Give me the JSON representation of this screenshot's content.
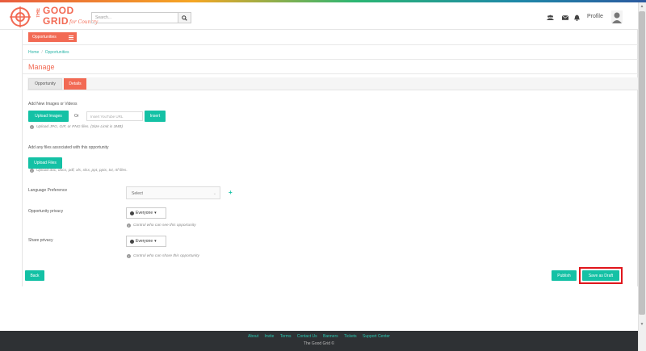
{
  "header": {
    "logo": {
      "line1": "THE",
      "line2": "GOOD",
      "line3": "GRID",
      "tagline": "for Country"
    },
    "search": {
      "placeholder": "Search..."
    },
    "profile_label": "Profile",
    "icons": [
      "users-icon",
      "mail-icon",
      "bell-icon"
    ]
  },
  "nav": {
    "opportunities_button": "Opportunities"
  },
  "breadcrumb": {
    "home": "Home",
    "separator": "/",
    "current": "Opportunities"
  },
  "page": {
    "title": "Manage"
  },
  "tabs": [
    {
      "label": "Opportunity",
      "active": false
    },
    {
      "label": "Details",
      "active": true
    }
  ],
  "media": {
    "section_label": "Add New Images or Videos",
    "upload_images_button": "Upload Images",
    "or_label": "Or",
    "youtube_placeholder": "Insert YouTube URL",
    "insert_button": "Insert",
    "hint": "Upload JPG, GIF, or PNG files. (Size Limit is 3MB)"
  },
  "files": {
    "section_label": "Add any files associated with this opportunity",
    "upload_files_button": "Upload Files",
    "hint": "Upload doc, docx, pdf, xls, xlsx, ppt, pptx, txt, rtf files."
  },
  "language": {
    "label": "Language Preference",
    "select_value": "Select"
  },
  "opportunity_privacy": {
    "label": "Opportunity privacy",
    "value": "Everyone",
    "hint": "Control who can see this opportunity"
  },
  "share_privacy": {
    "label": "Share privacy",
    "value": "Everyone",
    "hint": "Control who can share this opportunity"
  },
  "actions": {
    "back": "Back",
    "publish": "Publish",
    "save_draft": "Save as Draft"
  },
  "footer": {
    "links": [
      "About",
      "Invite",
      "Terms",
      "Contact Us",
      "Banners",
      "Tickets",
      "Support Center"
    ],
    "copyright": "The Good Grid ©"
  },
  "colors": {
    "accent": "#f26a54",
    "teal": "#14c1a5",
    "highlight": "#e0161c",
    "footer_bg": "#2e3134"
  }
}
